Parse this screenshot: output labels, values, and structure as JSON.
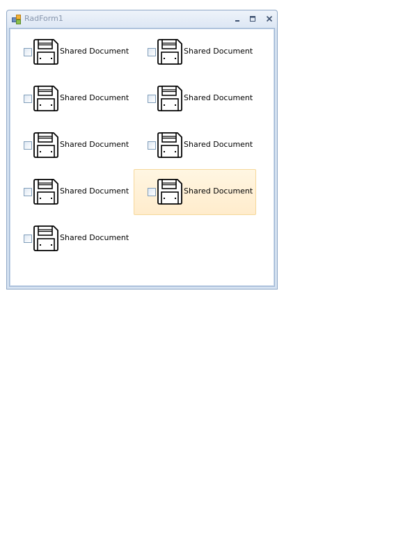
{
  "window": {
    "title": "RadForm1",
    "buttons": {
      "minimize_icon": "minimize-icon",
      "maximize_icon": "maximize-icon",
      "close_icon": "close-icon"
    }
  },
  "items": [
    {
      "label": "Shared Document",
      "checked": false,
      "hover": false,
      "icon": "floppy-disk-icon"
    },
    {
      "label": "Shared Document",
      "checked": false,
      "hover": false,
      "icon": "floppy-disk-icon"
    },
    {
      "label": "Shared Document",
      "checked": false,
      "hover": false,
      "icon": "floppy-disk-icon"
    },
    {
      "label": "Shared Document",
      "checked": false,
      "hover": false,
      "icon": "floppy-disk-icon"
    },
    {
      "label": "Shared Document",
      "checked": false,
      "hover": false,
      "icon": "floppy-disk-icon"
    },
    {
      "label": "Shared Document",
      "checked": false,
      "hover": false,
      "icon": "floppy-disk-icon"
    },
    {
      "label": "Shared Document",
      "checked": false,
      "hover": false,
      "icon": "floppy-disk-icon"
    },
    {
      "label": "Shared Document",
      "checked": false,
      "hover": true,
      "icon": "floppy-disk-icon"
    },
    {
      "label": "Shared Document",
      "checked": false,
      "hover": false,
      "icon": "floppy-disk-icon"
    }
  ],
  "colors": {
    "hover_background": "#ffeccc",
    "hover_border": "#f5d79a",
    "frame_border": "#8ea7c6"
  }
}
